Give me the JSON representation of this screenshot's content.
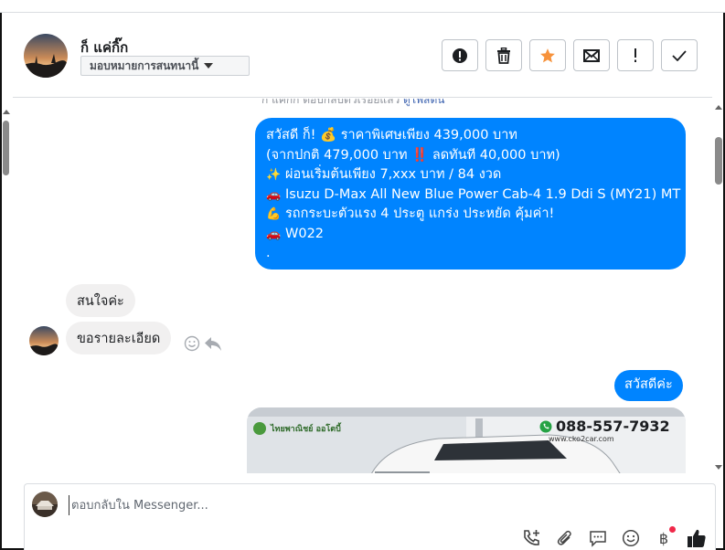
{
  "header": {
    "contact_name": "ก็ แค่กิ๊ก",
    "assign_label": "มอบหมายการสนทนานี้",
    "tools": [
      "spam-icon",
      "trash-icon",
      "star-icon",
      "mail-icon",
      "important-icon",
      "check-icon"
    ],
    "star_color": "#f7923b"
  },
  "conversation": {
    "faded_prefix": "ก็ แค่กิ๊ก ตอบกลับตัวเรื่อยแล้ว",
    "faded_link": "ดูโพสต์นี้",
    "promo_message": {
      "lines": [
        {
          "icon": "",
          "text": "สวัสดี ก็! 💰 ราคาพิเศษเพียง 439,000 บาท"
        },
        {
          "icon": "",
          "text": "(จากปกติ 479,000 บาท ‼️ ลดทันที 40,000 บาท)"
        },
        {
          "icon": "✨",
          "text": "ผ่อนเริ่มต้นเพียง 7,xxx บาท / 84 งวด"
        },
        {
          "icon": "🚗",
          "text": "Isuzu D-Max All New Blue Power Cab-4 1.9 Ddi S (MY21) MT"
        },
        {
          "icon": "💪",
          "text": "รถกระบะตัวแรง 4 ประตู แกร่ง ประหยัด คุ้มค่า!"
        },
        {
          "icon": "🚗",
          "text": "W022"
        },
        {
          "icon": "",
          "text": "."
        }
      ]
    },
    "incoming": [
      "สนใจค่ะ",
      "ขอรายละเอียด"
    ],
    "outgoing_greeting": "สวัสดีค่ะ",
    "image_card": {
      "brand": "ไทยพาณิชย์ ออโตบี้",
      "phone": "088-557-7932",
      "website": "www.cko2car.com"
    },
    "bubble_color": "#0084ff"
  },
  "composer": {
    "placeholder": "ตอบกลับใน Messenger...",
    "icons": [
      "call-add-icon",
      "attachment-icon",
      "saved-reply-icon",
      "emoji-icon",
      "baht-icon",
      "like-icon"
    ],
    "baht_symbol": "฿"
  }
}
